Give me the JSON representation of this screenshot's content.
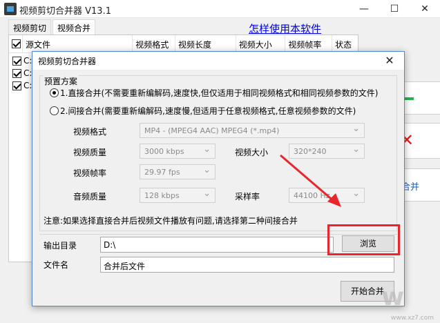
{
  "main": {
    "title": "视频剪切合并器 V13.1",
    "controls": {
      "minimize": "—",
      "maximize": "☐",
      "close": "✕"
    },
    "tabs": [
      {
        "label": "视频剪切"
      },
      {
        "label": "视频合并"
      }
    ],
    "help_link": "怎样使用本软件",
    "columns": {
      "file": "源文件",
      "format": "视频格式",
      "length": "视频长度",
      "size": "视频大小",
      "fps": "视频帧率",
      "status": "状态"
    },
    "rows": [
      {
        "label": "C:"
      },
      {
        "label": "C:"
      },
      {
        "label": "C:"
      }
    ],
    "side_merge_label": "合并"
  },
  "dialog": {
    "title": "视频剪切合并器",
    "close": "✕",
    "preset_group": "预置方案",
    "option1": "1.直接合并(不需要重新编解码,速度快,但仅适用于相同视频格式和相同视频参数的文件)",
    "option2": "2.间接合并(需要重新编解码,速度慢,但适用于任意视频格式,任意视频参数的文件)",
    "fields": {
      "format_label": "视频格式",
      "format_value": "MP4 - (MPEG4 AAC) MPEG4 (*.mp4)",
      "quality_label": "视频质量",
      "quality_value": "3000 kbps",
      "size_label": "视频大小",
      "size_value": "320*240",
      "fps_label": "视频帧率",
      "fps_value": "29.97 fps",
      "audio_label": "音频质量",
      "audio_value": "128 kbps",
      "samplerate_label": "采样率",
      "samplerate_value": "44100 Hz"
    },
    "note": "注意:如果选择直接合并后视频文件播放有问题,请选择第二种间接合并",
    "output_label": "输出目录",
    "output_value": "D:\\",
    "browse_button": "浏览",
    "filename_label": "文件名",
    "filename_value": "合并后文件",
    "start_button": "开始合并"
  },
  "colors": {
    "highlight": "#e8262c",
    "link": "#0000ee",
    "dialog_border": "#4b8bd6"
  },
  "watermark": {
    "text": "w",
    "sub": "www.xz7.com"
  }
}
